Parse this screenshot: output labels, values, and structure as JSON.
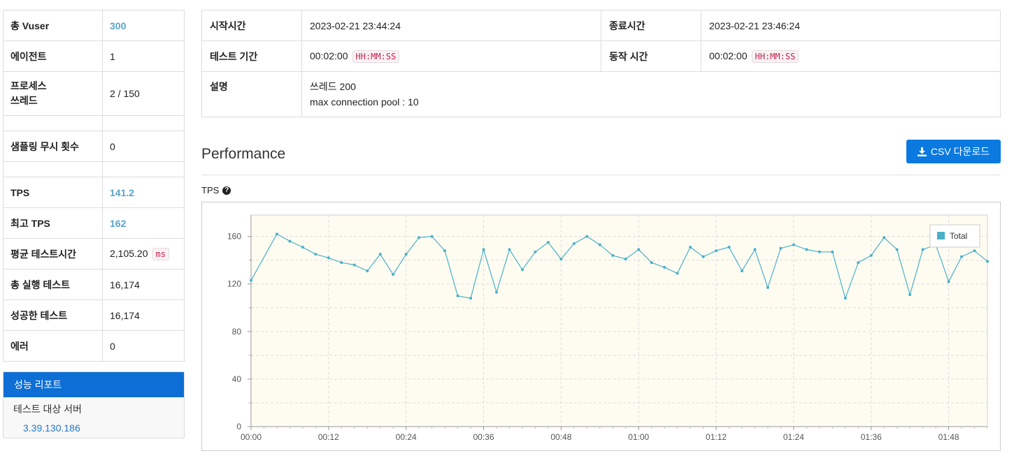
{
  "stats": {
    "rows": [
      {
        "label": "총 Vuser",
        "value": "300",
        "highlight": true
      },
      {
        "label": "에이전트",
        "value": "1",
        "highlight": false
      },
      {
        "label": "프로세스\n쓰레드",
        "value": "2 / 150",
        "highlight": false
      },
      {
        "label": "샘플링 무시 횟수",
        "value": "0",
        "highlight": false
      },
      {
        "label": "TPS",
        "value": "141.2",
        "highlight": true
      },
      {
        "label": "최고 TPS",
        "value": "162",
        "highlight": true
      },
      {
        "label": "평균 테스트시간",
        "value": "2,105.20",
        "unit": "ms",
        "highlight": false
      },
      {
        "label": "총 실행 테스트",
        "value": "16,174",
        "highlight": false
      },
      {
        "label": "성공한 테스트",
        "value": "16,174",
        "highlight": false
      },
      {
        "label": "에러",
        "value": "0",
        "highlight": false
      }
    ]
  },
  "nav": {
    "active": "성능 리포트",
    "sub": "테스트 대상 서버",
    "server": "3.39.130.186"
  },
  "info": {
    "start_label": "시작시간",
    "start_value": "2023-02-21 23:44:24",
    "end_label": "종료시간",
    "end_value": "2023-02-21 23:46:24",
    "duration_label": "테스트 기간",
    "duration_value": "00:02:00",
    "duration_unit": "HH:MM:SS",
    "run_label": "동작 시간",
    "run_value": "00:02:00",
    "run_unit": "HH:MM:SS",
    "desc_label": "설명",
    "desc_line1": "쓰레드 200",
    "desc_line2": "max connection pool : 10"
  },
  "performance": {
    "title": "Performance",
    "csv_button": "CSV 다운로드",
    "tps_label": "TPS"
  },
  "colors": {
    "line": "#4ab0c9",
    "plot_bg": "#fefcf1",
    "button": "#0a7ae0",
    "highlight": "#5aa3cc"
  },
  "chart_data": {
    "type": "line",
    "x_ticks": [
      "00:00",
      "00:12",
      "00:24",
      "00:36",
      "00:48",
      "01:00",
      "01:12",
      "01:24",
      "01:36",
      "01:48"
    ],
    "y_ticks": [
      0,
      40,
      80,
      120,
      160
    ],
    "ylim": [
      0,
      178
    ],
    "xlim_seconds": [
      0,
      114
    ],
    "legend": "top-right",
    "series": [
      {
        "name": "Total",
        "x_seconds": [
          0,
          4,
          6,
          8,
          10,
          12,
          14,
          16,
          18,
          20,
          22,
          24,
          26,
          28,
          30,
          32,
          34,
          36,
          38,
          40,
          42,
          44,
          46,
          48,
          50,
          52,
          54,
          56,
          58,
          60,
          62,
          64,
          66,
          68,
          70,
          72,
          74,
          76,
          78,
          80,
          82,
          84,
          86,
          88,
          90,
          92,
          94,
          96,
          98,
          100,
          102,
          104,
          106,
          108,
          110,
          112,
          114
        ],
        "values": [
          123,
          162,
          156,
          151,
          145,
          142,
          138,
          136,
          131,
          145,
          128,
          145,
          159,
          160,
          148,
          110,
          108,
          149,
          113,
          149,
          132,
          147,
          155,
          141,
          154,
          160,
          153,
          144,
          141,
          149,
          138,
          134,
          129,
          151,
          143,
          148,
          151,
          131,
          149,
          117,
          150,
          153,
          149,
          147,
          147,
          108,
          138,
          144,
          159,
          149,
          111,
          149,
          153,
          122,
          143,
          148,
          139
        ]
      }
    ]
  }
}
